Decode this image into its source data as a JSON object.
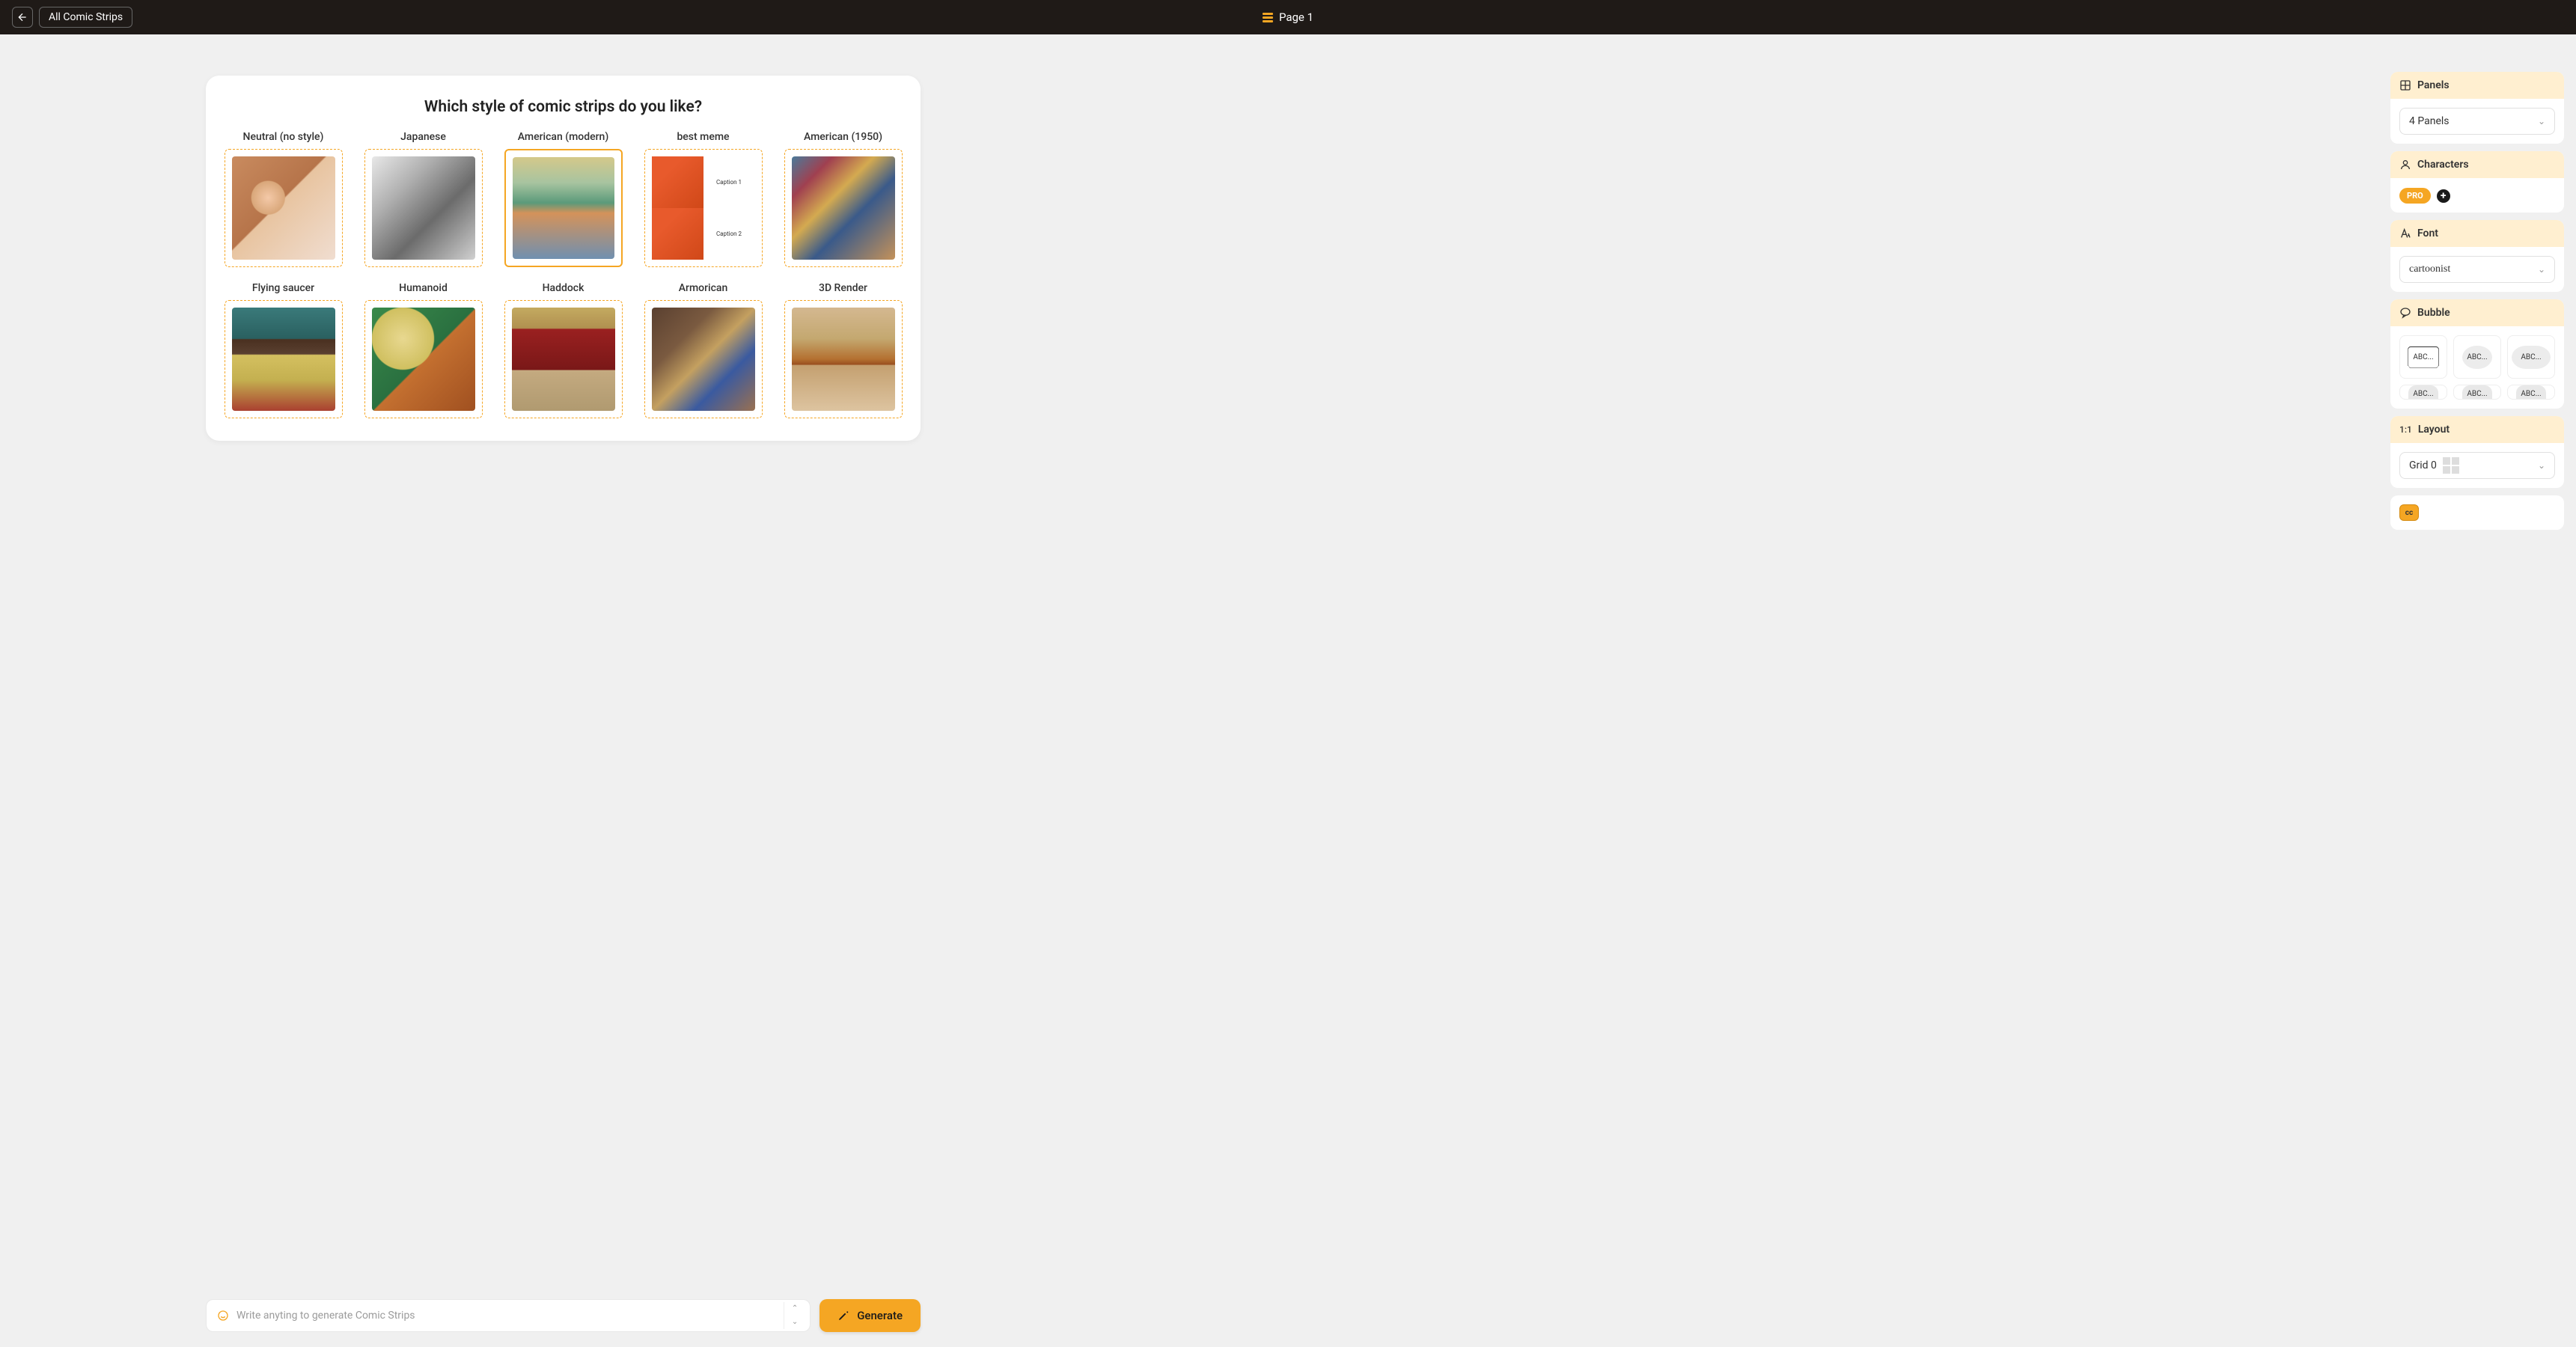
{
  "header": {
    "back_label": "All Comic Strips",
    "page_label": "Page 1"
  },
  "styles": {
    "heading": "Which style of comic strips do you like?",
    "selected_index": 2,
    "items": [
      {
        "label": "Neutral (no style)",
        "thumb_class": "t-neutral"
      },
      {
        "label": "Japanese",
        "thumb_class": "t-japanese"
      },
      {
        "label": "American (modern)",
        "thumb_class": "t-american"
      },
      {
        "label": "best meme",
        "thumb_class": "t-meme",
        "meme_captions": [
          "Caption 1",
          "Caption 2"
        ]
      },
      {
        "label": "American (1950)",
        "thumb_class": "t-american1950"
      },
      {
        "label": "Flying saucer",
        "thumb_class": "t-flying"
      },
      {
        "label": "Humanoid",
        "thumb_class": "t-humanoid"
      },
      {
        "label": "Haddock",
        "thumb_class": "t-haddock"
      },
      {
        "label": "Armorican",
        "thumb_class": "t-armorican"
      },
      {
        "label": "3D Render",
        "thumb_class": "t-3d"
      }
    ]
  },
  "sidebar": {
    "panels": {
      "title": "Panels",
      "value": "4 Panels"
    },
    "characters": {
      "title": "Characters",
      "pro_label": "PRO"
    },
    "font": {
      "title": "Font",
      "value": "cartoonist"
    },
    "bubble": {
      "title": "Bubble",
      "sample": "ABC..."
    },
    "layout": {
      "title": "Layout",
      "ratio": "1:1",
      "value": "Grid 0"
    },
    "cc_label": "cc"
  },
  "prompt": {
    "placeholder": "Write anyting to generate Comic Strips",
    "generate_label": "Generate"
  },
  "colors": {
    "accent": "#f5a623",
    "topbar": "#1f1a17"
  }
}
